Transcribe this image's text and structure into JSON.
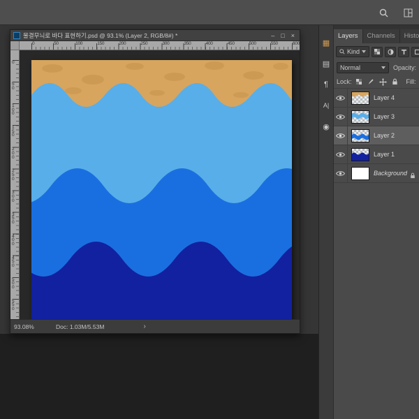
{
  "app": {
    "search_icon": "search",
    "workspace_icon": "workspace-grid"
  },
  "document": {
    "title": "물결무늬로 바다 표현하기.psd @ 93.1% (Layer 2, RGB/8#) *",
    "buttons": {
      "minimize": "–",
      "maximize": "□",
      "close": "×"
    },
    "ruler_numbers": [
      "0",
      "50",
      "100",
      "150",
      "200",
      "250",
      "300",
      "350",
      "400",
      "450",
      "500",
      "550",
      "600"
    ],
    "status": {
      "zoom": "93.08%",
      "doc_size": "Doc: 1.03M/5.53M",
      "expand": "›"
    }
  },
  "artwork": {
    "colors": {
      "sand": "#d7a55e",
      "sand_spot": "#c5914a",
      "sky": "#58aee9",
      "ocean": "#1a6fe0",
      "navy": "#12219f"
    }
  },
  "panel": {
    "tabs": [
      {
        "label": "Layers"
      },
      {
        "label": "Channels"
      },
      {
        "label": "History"
      }
    ],
    "filter_kind": "Kind",
    "blend_mode": "Normal",
    "opacity_label": "Opacity:",
    "lock_label": "Lock:",
    "fill_label": "Fill:",
    "strip": [
      {
        "name": "color-panel",
        "glyph": "▦"
      },
      {
        "name": "libraries-panel",
        "glyph": "▤"
      },
      {
        "name": "paragraph-panel",
        "glyph": "¶"
      },
      {
        "name": "character-panel",
        "glyph": "A|"
      },
      {
        "name": "adjustments-panel",
        "glyph": "◉"
      }
    ],
    "layers": [
      {
        "name": "Layer 4"
      },
      {
        "name": "Layer 3"
      },
      {
        "name": "Layer 2"
      },
      {
        "name": "Layer 1"
      },
      {
        "name": "Background"
      }
    ]
  }
}
